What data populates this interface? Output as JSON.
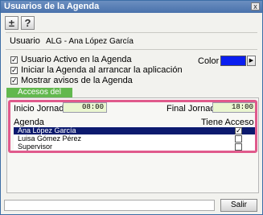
{
  "window": {
    "title": "Usuarios de la Agenda",
    "close_glyph": "x"
  },
  "toolbar": {
    "add_glyph": "±",
    "help_glyph": "?"
  },
  "user": {
    "label": "Usuario",
    "value": "ALG - Ana López García"
  },
  "options": [
    {
      "label": "Usuario Activo en la Agenda",
      "checked": true
    },
    {
      "label": "Iniciar la Agenda al arrancar la aplicación",
      "checked": true
    },
    {
      "label": "Mostrar avisos de la Agenda",
      "checked": true
    }
  ],
  "color": {
    "label": "Color",
    "value": "#0a1ef0",
    "button_glyph": "▶"
  },
  "tab": {
    "label": "Accesos del Usuario"
  },
  "schedule": {
    "start_label": "Inicio Jornada",
    "start_value": "08:00",
    "end_label": "Final Jornada",
    "end_value": "18:00"
  },
  "access": {
    "col_agenda": "Agenda",
    "col_access": "Tiene Acceso",
    "rows": [
      {
        "name": "Ana López García",
        "access": true,
        "selected": true
      },
      {
        "name": "Luisa Gómez Pérez",
        "access": false,
        "selected": false
      },
      {
        "name": "Supervisor",
        "access": false,
        "selected": false
      }
    ]
  },
  "footer": {
    "exit_label": "Salir"
  }
}
